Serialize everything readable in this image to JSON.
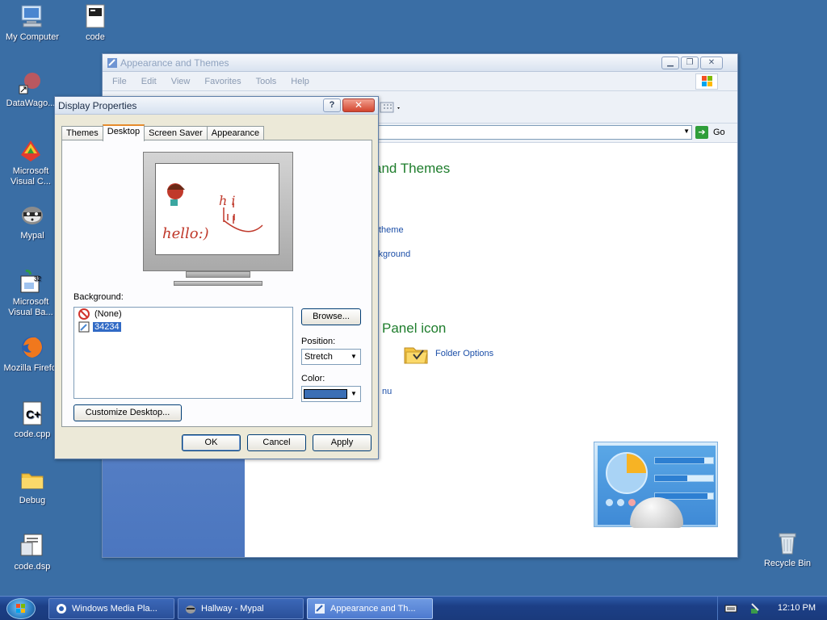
{
  "desktop": {
    "icons": [
      {
        "label": "My Computer"
      },
      {
        "label": "code"
      },
      {
        "label": "DataWago..."
      },
      {
        "label": "Microsoft Visual C..."
      },
      {
        "label": "Mypal"
      },
      {
        "label": "Microsoft Visual Ba..."
      },
      {
        "label": "Mozilla Firefox"
      },
      {
        "label": "code.cpp"
      },
      {
        "label": "Debug"
      },
      {
        "label": "code.dsp"
      },
      {
        "label": "Recycle Bin"
      }
    ]
  },
  "explorer": {
    "title": "Appearance and Themes",
    "menu": [
      "File",
      "Edit",
      "View",
      "Favorites",
      "Tools",
      "Help"
    ],
    "go_label": "Go",
    "heading_task": "and Themes",
    "links": [
      "theme",
      "ckground"
    ],
    "heading_panel": "Panel icon",
    "folder_options": "Folder Options",
    "menu_link": "nu",
    "art": {
      "bars": [
        0.85,
        0.55,
        0.9
      ]
    }
  },
  "dialog": {
    "title": "Display Properties",
    "help": "?",
    "close": "✕",
    "tabs": [
      "Themes",
      "Desktop",
      "Screen Saver",
      "Appearance"
    ],
    "active_tab": "Desktop",
    "preview_text": "hello:)",
    "preview_hi": "h i",
    "background_label": "Background:",
    "background_items": [
      {
        "label": "(None)"
      },
      {
        "label": "34234"
      }
    ],
    "browse_label": "Browse...",
    "position_label": "Position:",
    "position_value": "Stretch",
    "color_label": "Color:",
    "color_value": "#3b6fb5",
    "customize_label": "Customize Desktop...",
    "ok": "OK",
    "cancel": "Cancel",
    "apply": "Apply"
  },
  "taskbar": {
    "tasks": [
      {
        "label": "Windows Media Pla..."
      },
      {
        "label": "Hallway - Mypal"
      },
      {
        "label": "Appearance and Th..."
      }
    ],
    "clock": "12:10 PM"
  }
}
